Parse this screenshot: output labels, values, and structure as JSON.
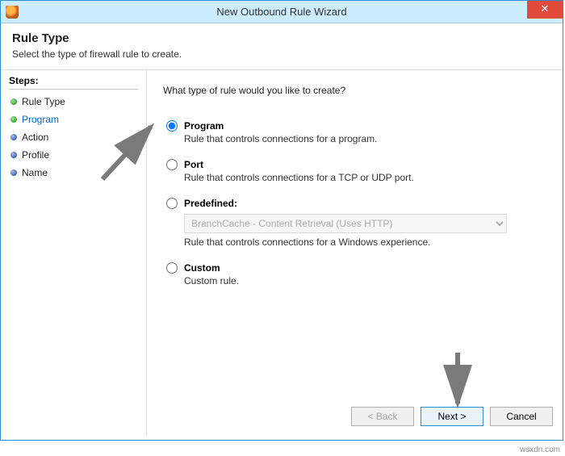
{
  "window": {
    "title": "New Outbound Rule Wizard",
    "close_glyph": "✕"
  },
  "header": {
    "title": "Rule Type",
    "subtitle": "Select the type of firewall rule to create."
  },
  "sidebar": {
    "steps_title": "Steps:",
    "items": [
      {
        "label": "Rule Type",
        "bullet": "green",
        "active": false
      },
      {
        "label": "Program",
        "bullet": "green",
        "active": true
      },
      {
        "label": "Action",
        "bullet": "blue",
        "active": false
      },
      {
        "label": "Profile",
        "bullet": "blue",
        "active": false
      },
      {
        "label": "Name",
        "bullet": "blue",
        "active": false
      }
    ]
  },
  "content": {
    "question": "What type of rule would you like to create?",
    "options": {
      "program": {
        "label": "Program",
        "desc": "Rule that controls connections for a program.",
        "checked": true
      },
      "port": {
        "label": "Port",
        "desc": "Rule that controls connections for a TCP or UDP port.",
        "checked": false
      },
      "predefined": {
        "label": "Predefined:",
        "desc": "Rule that controls connections for a Windows experience.",
        "select_value": "BranchCache - Content Retrieval (Uses HTTP)",
        "checked": false
      },
      "custom": {
        "label": "Custom",
        "desc": "Custom rule.",
        "checked": false
      }
    }
  },
  "footer": {
    "back": "< Back",
    "next": "Next >",
    "cancel": "Cancel"
  },
  "watermark": "wsxdn.com"
}
